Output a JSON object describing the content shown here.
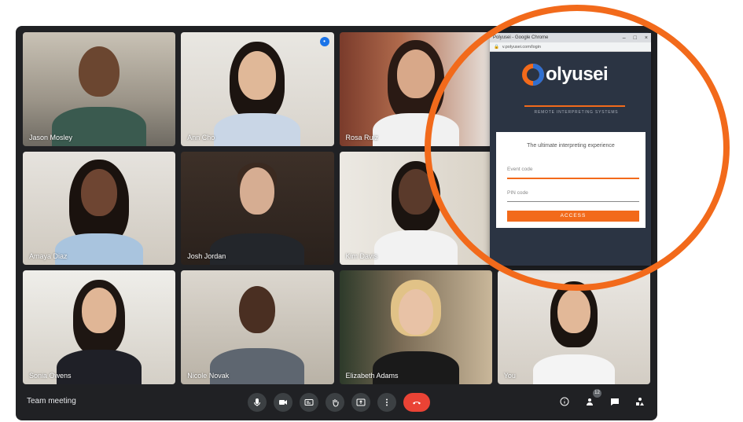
{
  "meeting": {
    "title": "Team meeting",
    "participant_count": "12",
    "participants": [
      {
        "name": "Jason Mosley"
      },
      {
        "name": "Ann Cho"
      },
      {
        "name": "Rosa Ruiz"
      },
      {
        "name": "Amaya Diaz"
      },
      {
        "name": "Josh Jordan"
      },
      {
        "name": "Kim Davis"
      },
      {
        "name": "Sonia Owens"
      },
      {
        "name": "Nicole Novak"
      },
      {
        "name": "Elizabeth Adams"
      },
      {
        "name": "You"
      }
    ]
  },
  "controls": {
    "mic": "mic-icon",
    "camera": "camera-icon",
    "captions": "captions-icon",
    "hand": "raise-hand-icon",
    "present": "present-icon",
    "more": "more-icon",
    "end": "end-call-icon"
  },
  "popup": {
    "window_title": "Polyusei - Google Chrome",
    "url": "v.polyusei.com/login",
    "logo_text": "olyusei",
    "tagline": "REMOTE INTERPRETING SYSTEMS",
    "card_title": "The ultimate interpreting experience",
    "event_code_placeholder": "Event code",
    "pin_placeholder": "PIN code",
    "access_label": "ACCESS"
  },
  "colors": {
    "accent": "#f26a1b",
    "meeting_bg": "#202124",
    "end_call": "#ea4335"
  }
}
